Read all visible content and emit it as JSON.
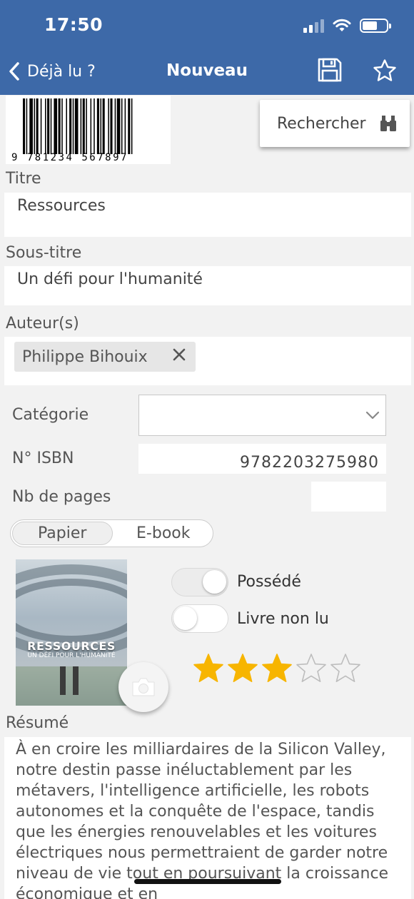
{
  "status_bar": {
    "time": "17:50"
  },
  "nav": {
    "back_label": "Déjà lu ?",
    "title": "Nouveau"
  },
  "barcode": {
    "digits": "9 781234 567897"
  },
  "search_button": {
    "label": "Rechercher"
  },
  "fields": {
    "titre": {
      "label": "Titre",
      "value": "Ressources"
    },
    "sous_titre": {
      "label": "Sous-titre",
      "value": "Un défi pour l'humanité"
    },
    "auteurs": {
      "label": "Auteur(s)",
      "chips": [
        "Philippe Bihouix"
      ]
    },
    "categorie": {
      "label": "Catégorie",
      "value": ""
    },
    "isbn": {
      "label": "N° ISBN",
      "value": "9782203275980"
    },
    "pages": {
      "label": "Nb de pages",
      "value": ""
    }
  },
  "format": {
    "options": [
      "Papier",
      "E-book"
    ],
    "selected": "Papier"
  },
  "cover": {
    "title": "RESSOURCES",
    "subtitle": "UN DÉFI POUR L'HUMANITÉ"
  },
  "toggles": {
    "possede": {
      "label": "Possédé",
      "on": true
    },
    "non_lu": {
      "label": "Livre non lu",
      "on": false
    }
  },
  "rating": {
    "value": 3,
    "max": 5,
    "color": "#f7b500"
  },
  "resume": {
    "label": "Résumé",
    "text": "À en croire les milliardaires de la Silicon Valley, notre destin passe inéluctablement par les métavers, l'intelligence artificielle, les robots autonomes et la conquête de l'espace, tandis que les énergies renouvelables et les voitures électriques nous permettraient de garder notre niveau de vie tout en poursuivant la croissance économique et en"
  },
  "colors": {
    "header": "#3d69a8",
    "background": "#f2f2f2"
  }
}
